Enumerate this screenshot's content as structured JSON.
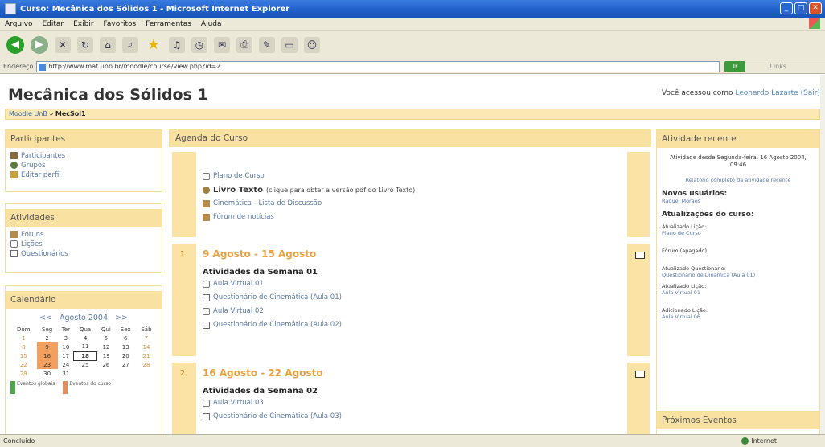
{
  "window": {
    "title": "Curso: Mecânica dos Sólidos 1 - Microsoft Internet Explorer",
    "buttons": [
      "_",
      "□",
      "✕"
    ]
  },
  "menu": [
    "Arquivo",
    "Editar",
    "Exibir",
    "Favoritos",
    "Ferramentas",
    "Ajuda"
  ],
  "address": {
    "label": "Endereço",
    "url": "http://www.mat.unb.br/moodle/course/view.php?id=2",
    "go": "Ir",
    "links": "Links"
  },
  "page": {
    "title": "Mecânica dos Sólidos 1",
    "logged_prefix": "Você acessou como",
    "logged_user": "Leonardo Lazarte",
    "logout": "(Sair)",
    "breadcrumb_home": "Moodle UnB",
    "breadcrumb_sep": " » ",
    "breadcrumb_current": "MecSol1"
  },
  "left": {
    "participants_title": "Participantes",
    "participants_items": [
      "Participantes",
      "Grupos",
      "Editar perfil"
    ],
    "activities_title": "Atividades",
    "activities_items": [
      "Fóruns",
      "Lições",
      "Questionários"
    ],
    "calendar_title": "Calendário",
    "calendar_prev": "<<",
    "calendar_month": "Agosto 2004",
    "calendar_next": ">>",
    "weekdays": [
      "Dom",
      "Seg",
      "Ter",
      "Qua",
      "Qui",
      "Sex",
      "Sáb"
    ],
    "weeks": [
      [
        "1",
        "2",
        "3",
        "4",
        "5",
        "6",
        "7"
      ],
      [
        "8",
        "9",
        "10",
        "11",
        "12",
        "13",
        "14"
      ],
      [
        "15",
        "16",
        "17",
        "18",
        "19",
        "20",
        "21"
      ],
      [
        "22",
        "23",
        "24",
        "25",
        "26",
        "27",
        "28"
      ],
      [
        "29",
        "30",
        "31",
        "",
        "",
        "",
        ""
      ]
    ],
    "legend_global": "Eventos globais",
    "legend_course": "Eventos do curso"
  },
  "center": {
    "title": "Agenda do Curso",
    "intro_items": [
      {
        "label": "Plano de Curso",
        "strong": "",
        "note": ""
      },
      {
        "label": "",
        "strong": "Livro Texto",
        "note": "(clique para obter a versão pdf do Livro Texto)"
      },
      {
        "label": "Cinemática - Lista de Discussão",
        "strong": "",
        "note": ""
      },
      {
        "label": "Fórum de notícias",
        "strong": "",
        "note": ""
      }
    ],
    "sections": [
      {
        "num": "1",
        "title": "9 Agosto - 15 Agosto",
        "subtitle": "Atividades da Semana 01",
        "items": [
          "Aula Virtual 01",
          "Questionário de Cinemática (Aula 01)",
          "Aula Virtual 02",
          "Questionário de Cinemática (Aula 02)"
        ]
      },
      {
        "num": "2",
        "title": "16 Agosto - 22 Agosto",
        "subtitle": "Atividades da Semana 02",
        "items": [
          "Aula Virtual 03",
          "Questionário de Cinemática (Aula 03)"
        ]
      }
    ]
  },
  "right": {
    "recent_title": "Atividade recente",
    "recent_since": "Atividade desde Segunda-feira, 16 Agosto 2004, 09:46",
    "recent_full": "Relatório completo da atividade recente",
    "new_users_title": "Novos usuários:",
    "new_user": "Raquel Moraes",
    "updates_title": "Atualizações do curso:",
    "updates": [
      {
        "head": "Atualizado Lição:",
        "link": "Plano de Curso"
      },
      {
        "head": "Fórum (apagado)",
        "link": ""
      },
      {
        "head": "Atualizado Questionário:",
        "link": "Questionário de Dinâmica (Aula 01)"
      },
      {
        "head": "Atualizado Lição:",
        "link": "Aula Virtual 01"
      },
      {
        "head": "Adicionado Lição:",
        "link": "Aula Virtual 06"
      }
    ],
    "upcoming_title": "Próximos Eventos"
  },
  "status": {
    "left": "Concluído",
    "zone": "Internet"
  }
}
